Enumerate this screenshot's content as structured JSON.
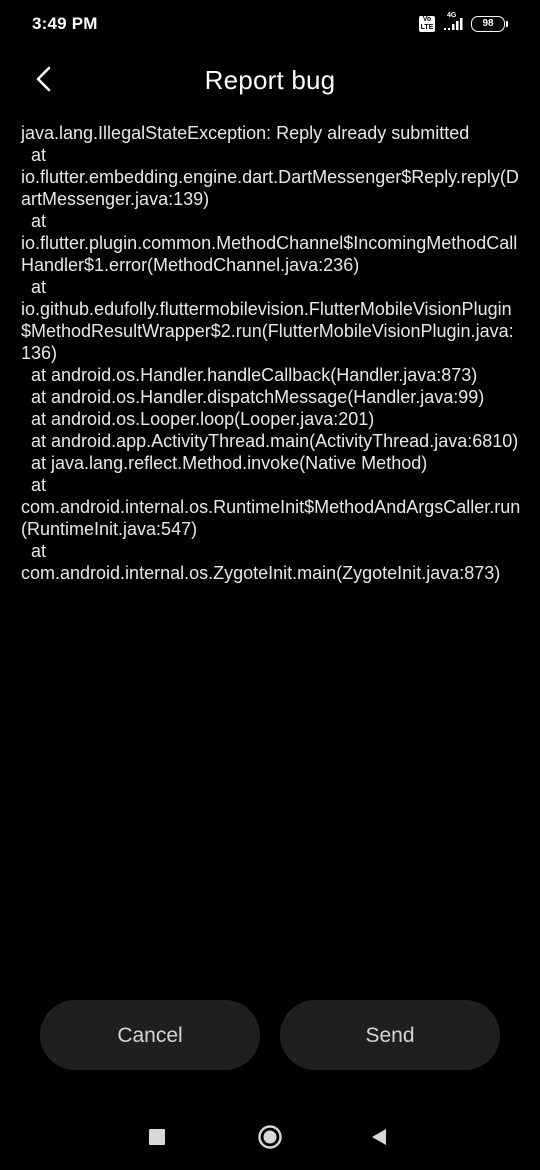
{
  "status_bar": {
    "time": "3:49 PM",
    "volte_label": "Vo LTE",
    "network_label": "4G",
    "battery_level": "98",
    "icons": [
      "volte-icon",
      "signal-icon",
      "battery-icon"
    ]
  },
  "header": {
    "title": "Report bug",
    "back_icon": "chevron-left-icon"
  },
  "log": {
    "text": "java.lang.IllegalStateException: Reply already submitted\n  at\nio.flutter.embedding.engine.dart.DartMessenger$Reply.reply(DartMessenger.java:139)\n  at\nio.flutter.plugin.common.MethodChannel$IncomingMethodCallHandler$1.error(MethodChannel.java:236)\n  at\nio.github.edufolly.fluttermobilevision.FlutterMobileVisionPlugin$MethodResultWrapper$2.run(FlutterMobileVisionPlugin.java:136)\n  at android.os.Handler.handleCallback(Handler.java:873)\n  at android.os.Handler.dispatchMessage(Handler.java:99)\n  at android.os.Looper.loop(Looper.java:201)\n  at android.app.ActivityThread.main(ActivityThread.java:6810)\n  at java.lang.reflect.Method.invoke(Native Method)\n  at\ncom.android.internal.os.RuntimeInit$MethodAndArgsCaller.run(RuntimeInit.java:547)\n  at\ncom.android.internal.os.ZygoteInit.main(ZygoteInit.java:873)"
  },
  "actions": {
    "cancel_label": "Cancel",
    "send_label": "Send"
  },
  "nav_bar": {
    "icons": [
      "recents-icon",
      "home-icon",
      "back-icon"
    ]
  },
  "colors": {
    "background": "#000000",
    "text": "#e8e8e8",
    "button_bg": "#1f1f1f",
    "button_text": "#d6d6d6"
  }
}
